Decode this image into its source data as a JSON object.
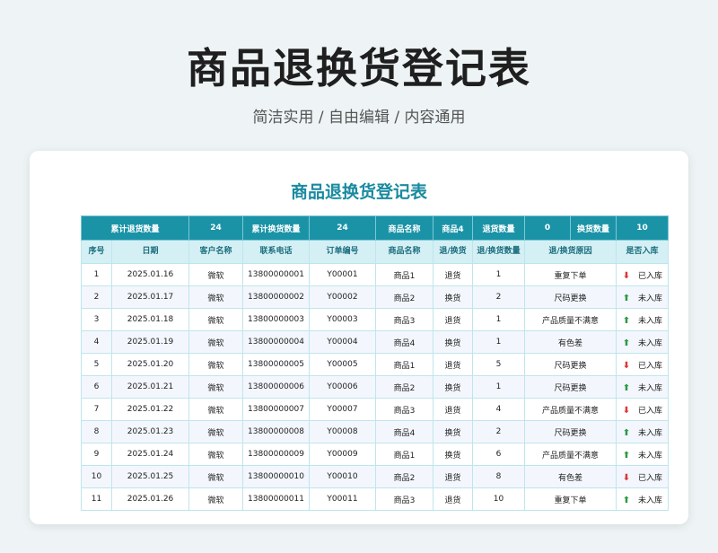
{
  "page": {
    "title": "商品退换货登记表",
    "subtitle": "简洁实用 / 自由编辑 / 内容通用"
  },
  "sheet": {
    "title": "商品退换货登记表",
    "summary": {
      "return_total_label": "累计退货数量",
      "return_total_value": "24",
      "exchange_total_label": "累计换货数量",
      "exchange_total_value": "24",
      "product_name_label": "商品名称",
      "product_name_value": "商品4",
      "return_qty_label": "退货数量",
      "return_qty_value": "0",
      "exchange_qty_label": "换货数量",
      "exchange_qty_value": "10"
    },
    "columns": [
      "序号",
      "日期",
      "客户名称",
      "联系电话",
      "订单编号",
      "商品名称",
      "退/换货",
      "退/换货数量",
      "退/换货原因",
      "是否入库"
    ],
    "rows": [
      {
        "no": "1",
        "date": "2025.01.16",
        "customer": "微软",
        "phone": "13800000001",
        "order": "Y00001",
        "product": "商品1",
        "type": "退货",
        "qty": "1",
        "reason": "重复下单",
        "stock": "已入库",
        "stock_icon": "down"
      },
      {
        "no": "2",
        "date": "2025.01.17",
        "customer": "微软",
        "phone": "13800000002",
        "order": "Y00002",
        "product": "商品2",
        "type": "换货",
        "qty": "2",
        "reason": "尺码更换",
        "stock": "未入库",
        "stock_icon": "up"
      },
      {
        "no": "3",
        "date": "2025.01.18",
        "customer": "微软",
        "phone": "13800000003",
        "order": "Y00003",
        "product": "商品3",
        "type": "退货",
        "qty": "1",
        "reason": "产品质量不满意",
        "stock": "未入库",
        "stock_icon": "up"
      },
      {
        "no": "4",
        "date": "2025.01.19",
        "customer": "微软",
        "phone": "13800000004",
        "order": "Y00004",
        "product": "商品4",
        "type": "换货",
        "qty": "1",
        "reason": "有色差",
        "stock": "未入库",
        "stock_icon": "up"
      },
      {
        "no": "5",
        "date": "2025.01.20",
        "customer": "微软",
        "phone": "13800000005",
        "order": "Y00005",
        "product": "商品1",
        "type": "退货",
        "qty": "5",
        "reason": "尺码更换",
        "stock": "已入库",
        "stock_icon": "down"
      },
      {
        "no": "6",
        "date": "2025.01.21",
        "customer": "微软",
        "phone": "13800000006",
        "order": "Y00006",
        "product": "商品2",
        "type": "换货",
        "qty": "1",
        "reason": "尺码更换",
        "stock": "未入库",
        "stock_icon": "up"
      },
      {
        "no": "7",
        "date": "2025.01.22",
        "customer": "微软",
        "phone": "13800000007",
        "order": "Y00007",
        "product": "商品3",
        "type": "退货",
        "qty": "4",
        "reason": "产品质量不满意",
        "stock": "已入库",
        "stock_icon": "down"
      },
      {
        "no": "8",
        "date": "2025.01.23",
        "customer": "微软",
        "phone": "13800000008",
        "order": "Y00008",
        "product": "商品4",
        "type": "换货",
        "qty": "2",
        "reason": "尺码更换",
        "stock": "未入库",
        "stock_icon": "up"
      },
      {
        "no": "9",
        "date": "2025.01.24",
        "customer": "微软",
        "phone": "13800000009",
        "order": "Y00009",
        "product": "商品1",
        "type": "换货",
        "qty": "6",
        "reason": "产品质量不满意",
        "stock": "未入库",
        "stock_icon": "up"
      },
      {
        "no": "10",
        "date": "2025.01.25",
        "customer": "微软",
        "phone": "13800000010",
        "order": "Y00010",
        "product": "商品2",
        "type": "退货",
        "qty": "8",
        "reason": "有色差",
        "stock": "已入库",
        "stock_icon": "down"
      },
      {
        "no": "11",
        "date": "2025.01.26",
        "customer": "微软",
        "phone": "13800000011",
        "order": "Y00011",
        "product": "商品3",
        "type": "退货",
        "qty": "10",
        "reason": "重复下单",
        "stock": "未入库",
        "stock_icon": "up"
      }
    ],
    "colors": {
      "title": "#1a8aa0",
      "summary_bg": "#1b93a7",
      "header_bg": "#d4f0f4",
      "arrow_down": "#d83a3a",
      "arrow_up": "#2e9a44"
    }
  }
}
